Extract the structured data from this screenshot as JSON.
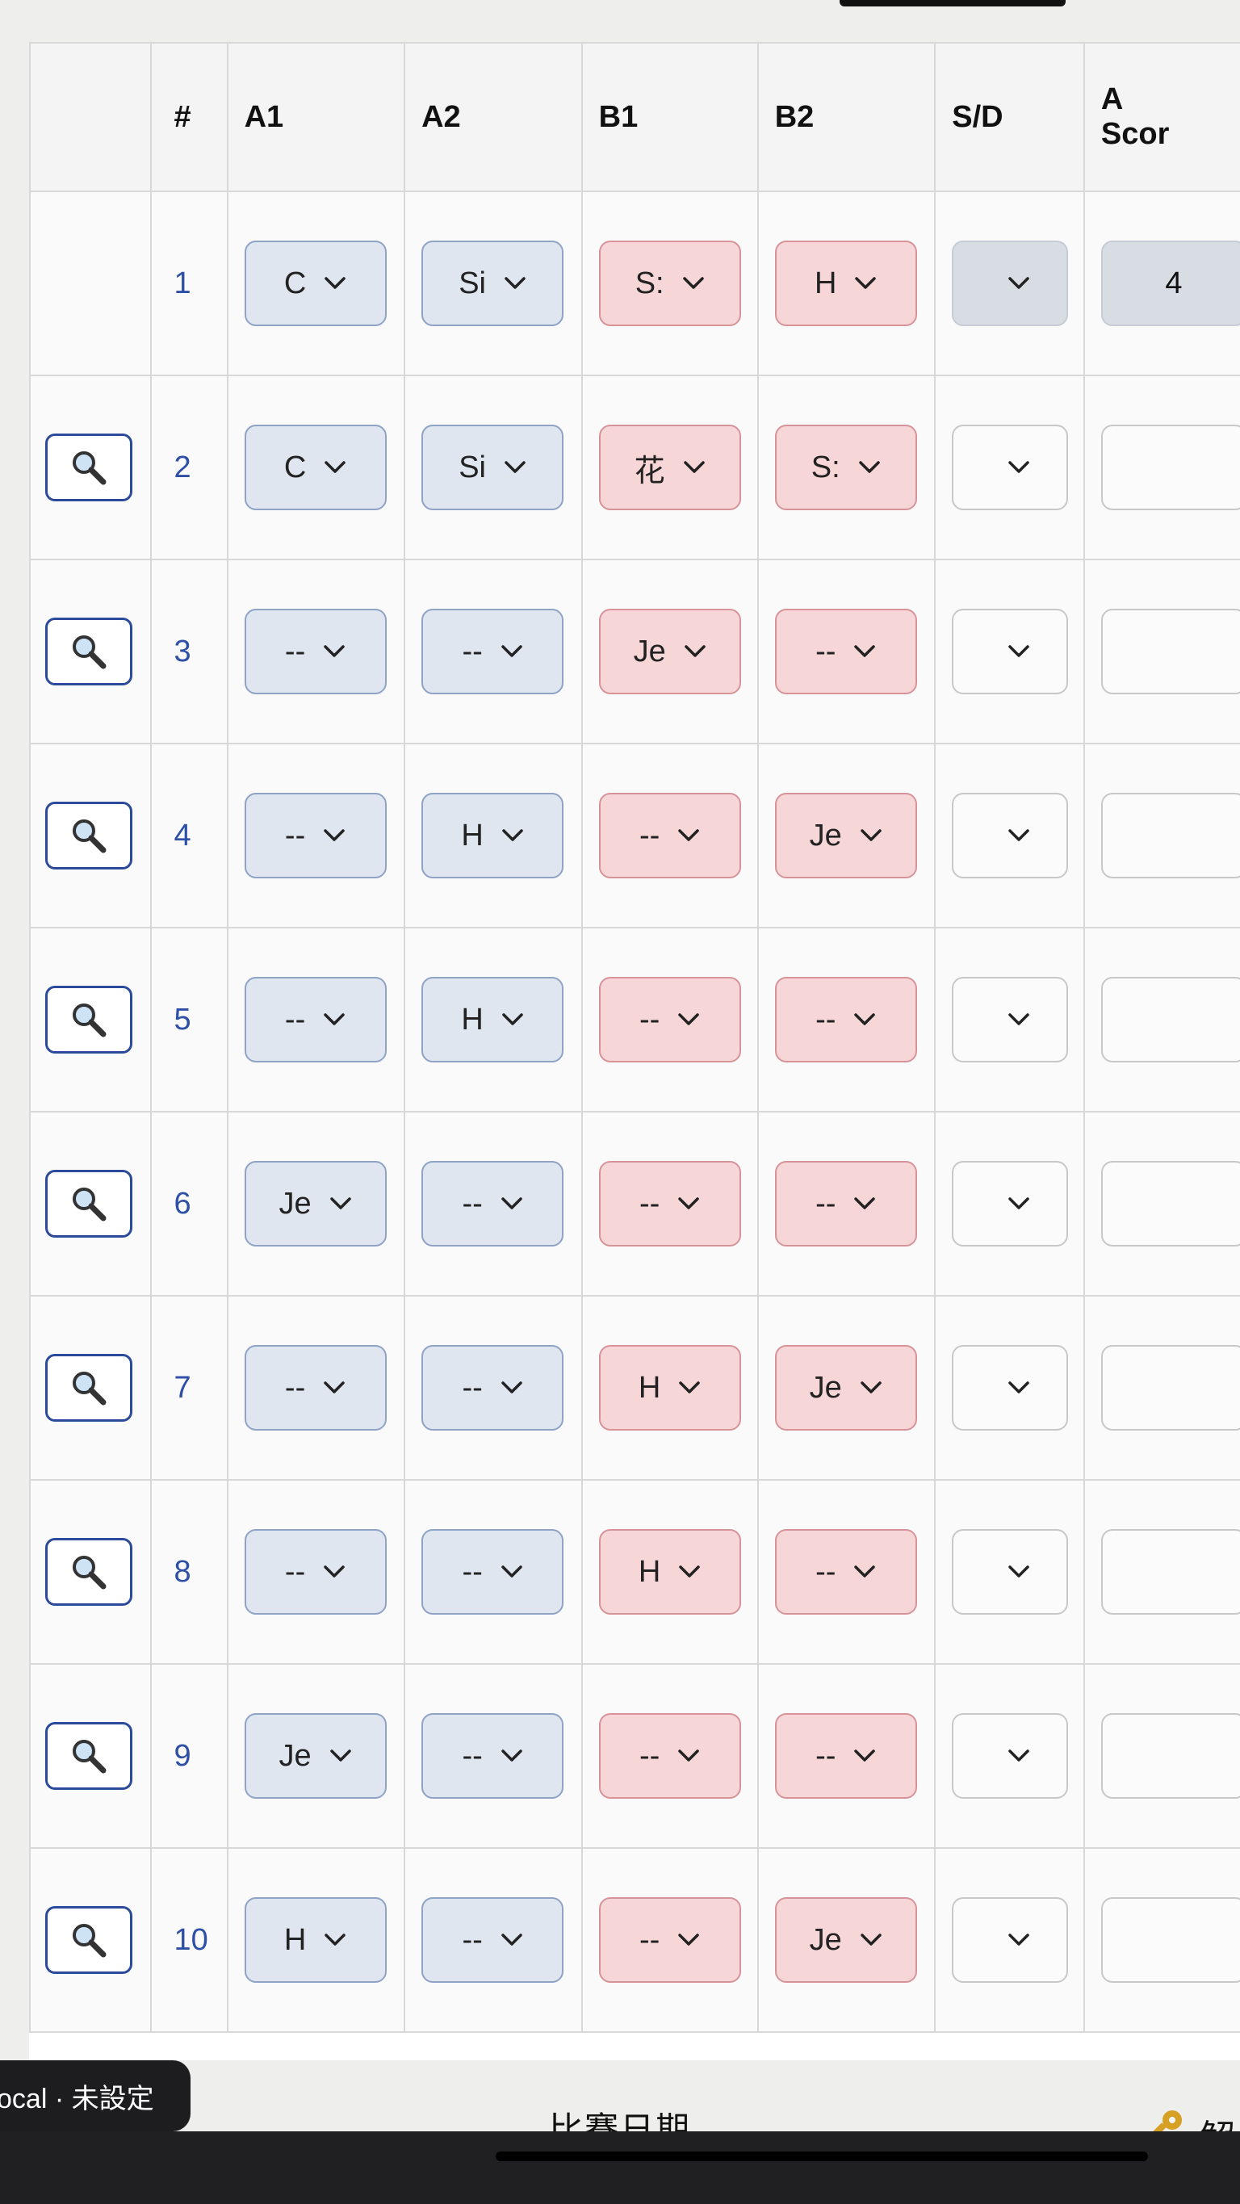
{
  "table": {
    "headers": [
      "",
      "#",
      "A1",
      "A2",
      "B1",
      "B2",
      "S/D",
      "A\nScor"
    ],
    "rows": [
      {
        "idx": "1",
        "a1": "C",
        "a2": "Si",
        "b1": "S:",
        "b2": "H",
        "sd": "",
        "score": "4",
        "has_search": false
      },
      {
        "idx": "2",
        "a1": "C",
        "a2": "Si",
        "b1": "花",
        "b2": "S:",
        "sd": "",
        "score": "",
        "has_search": true
      },
      {
        "idx": "3",
        "a1": "--",
        "a2": "--",
        "b1": "Je",
        "b2": "--",
        "sd": "",
        "score": "",
        "has_search": true
      },
      {
        "idx": "4",
        "a1": "--",
        "a2": "H",
        "b1": "--",
        "b2": "Je",
        "sd": "",
        "score": "",
        "has_search": true
      },
      {
        "idx": "5",
        "a1": "--",
        "a2": "H",
        "b1": "--",
        "b2": "--",
        "sd": "",
        "score": "",
        "has_search": true
      },
      {
        "idx": "6",
        "a1": "Je",
        "a2": "--",
        "b1": "--",
        "b2": "--",
        "sd": "",
        "score": "",
        "has_search": true
      },
      {
        "idx": "7",
        "a1": "--",
        "a2": "--",
        "b1": "H",
        "b2": "Je",
        "sd": "",
        "score": "",
        "has_search": true
      },
      {
        "idx": "8",
        "a1": "--",
        "a2": "--",
        "b1": "H",
        "b2": "--",
        "sd": "",
        "score": "",
        "has_search": true
      },
      {
        "idx": "9",
        "a1": "Je",
        "a2": "--",
        "b1": "--",
        "b2": "--",
        "sd": "",
        "score": "",
        "has_search": true
      },
      {
        "idx": "10",
        "a1": "H",
        "a2": "--",
        "b1": "--",
        "b2": "Je",
        "sd": "",
        "score": "",
        "has_search": true
      }
    ]
  },
  "toast": {
    "text": "ocal · 未設定"
  },
  "bottom": {
    "label": "比賽日期",
    "right_label": "解"
  },
  "icons": {
    "search": "magnifier-icon",
    "dropdown": "chevron-down-icon",
    "key": "key-icon"
  },
  "colors": {
    "team_a_bg": "#e0e6ef",
    "team_b_bg": "#f7d6d8",
    "index_text": "#2d4fa5"
  }
}
